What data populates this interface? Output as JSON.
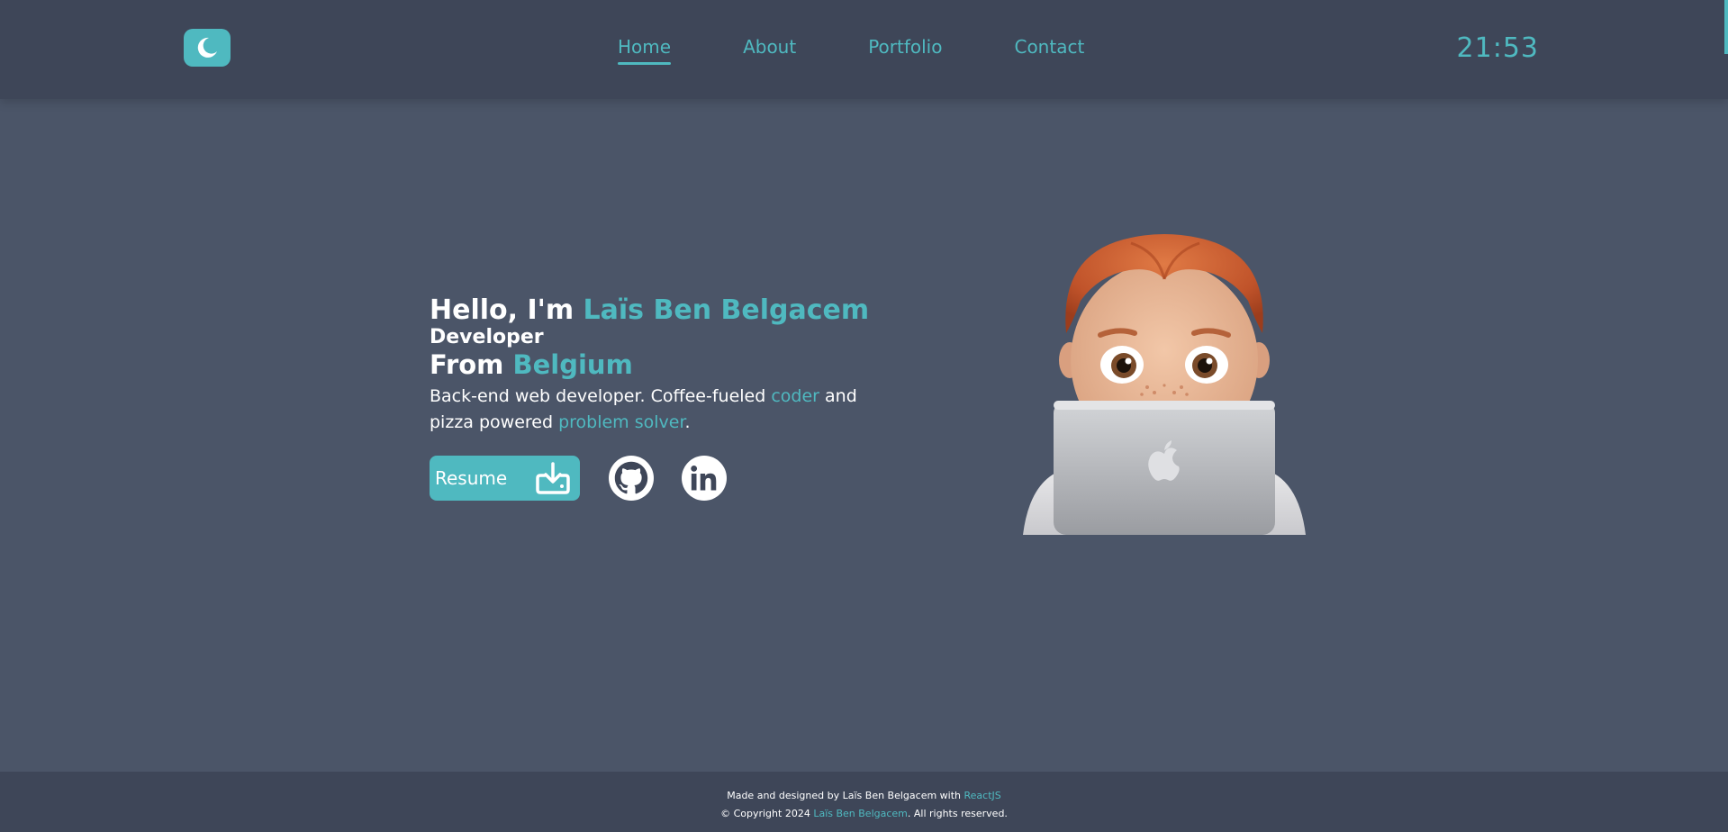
{
  "header": {
    "nav": {
      "home": "Home",
      "about": "About",
      "portfolio": "Portfolio",
      "contact": "Contact"
    },
    "clock": "21:53",
    "theme_icon": "moon-icon"
  },
  "hero": {
    "hello_prefix": "Hello, I'm",
    "name": "Laïs Ben Belgacem",
    "role": "Developer",
    "from_prefix": "From",
    "country": "Belgium",
    "desc_part1": "Back-end web developer. Coffee-fueled",
    "desc_coder": "coder",
    "desc_part2": "and pizza powered",
    "desc_solver": "problem solver",
    "desc_end": ".",
    "resume_label": "Resume",
    "resume_icon": "download-icon",
    "github_icon": "github-icon",
    "linkedin_icon": "linkedin-icon",
    "avatar": "memoji-avatar-with-laptop"
  },
  "footer": {
    "line1_prefix": "Made and designed by Laïs Ben Belgacem with",
    "line1_link": "ReactJS",
    "line2_prefix": "© Copyright 2024",
    "line2_link": "Laïs Ben Belgacem",
    "line2_suffix": ". All rights reserved."
  },
  "colors": {
    "accent": "#4fb9c0",
    "header_bg": "#3e4658",
    "page_bg": "#4b5568"
  }
}
